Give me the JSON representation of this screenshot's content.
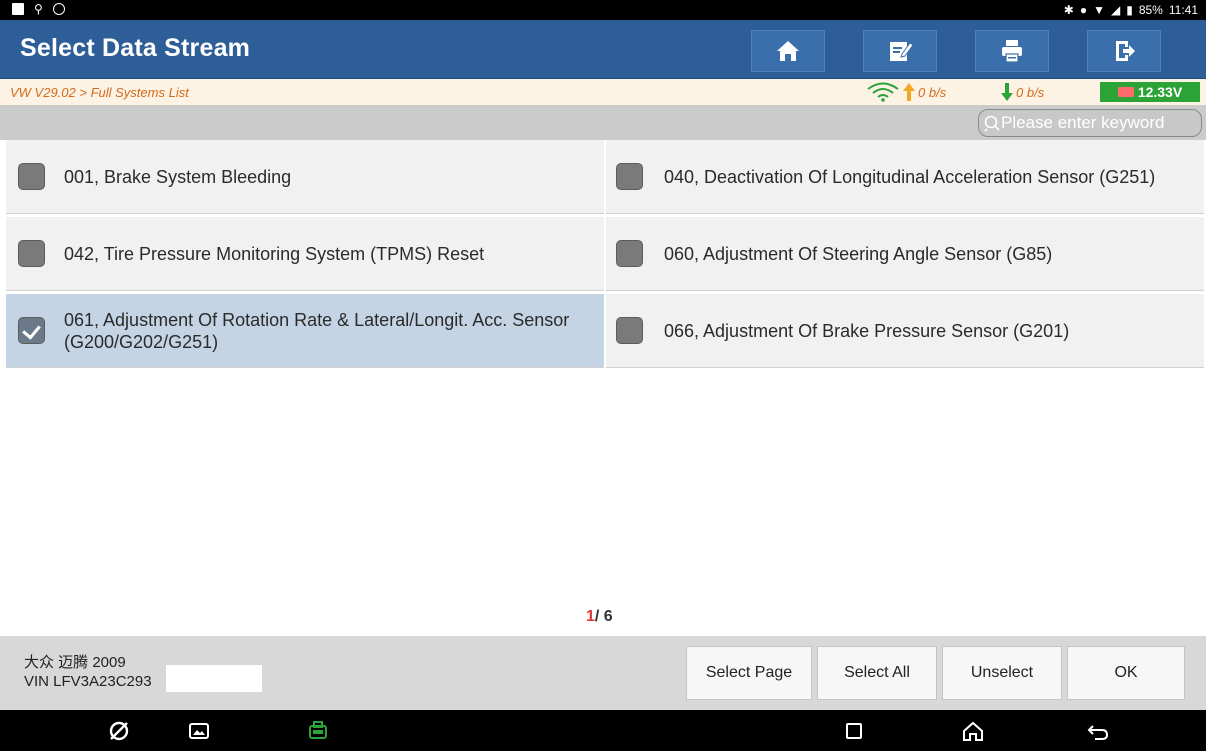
{
  "status_bar": {
    "battery_percent": "85%",
    "time": "11:41"
  },
  "titlebar": {
    "title": "Select Data Stream",
    "buttons": [
      "home-icon",
      "edit-icon",
      "print-icon",
      "exit-icon"
    ]
  },
  "crumbbar": {
    "breadcrumb": "VW V29.02 > Full Systems List",
    "upload_rate": "0 b/s",
    "download_rate": "0 b/s",
    "voltage": "12.33V"
  },
  "search": {
    "placeholder": "Please enter keyword"
  },
  "items": [
    {
      "label": "001, Brake System Bleeding",
      "checked": false
    },
    {
      "label": "040, Deactivation Of Longitudinal Acceleration Sensor (G251)",
      "checked": false
    },
    {
      "label": "042, Tire Pressure Monitoring System (TPMS) Reset",
      "checked": false
    },
    {
      "label": "060, Adjustment Of Steering Angle Sensor (G85)",
      "checked": false
    },
    {
      "label": "061, Adjustment Of Rotation Rate & Lateral/Longit. Acc. Sensor (G200/G202/G251)",
      "checked": true
    },
    {
      "label": "066, Adjustment Of Brake Pressure Sensor (G201)",
      "checked": false
    }
  ],
  "pager": {
    "current": "1",
    "total": "/ 6"
  },
  "footer": {
    "car_model": "大众 迈腾 2009",
    "vin": "VIN LFV3A23C293"
  },
  "actions": {
    "select_page": "Select Page",
    "select_all": "Select All",
    "unselect": "Unselect",
    "ok": "OK"
  },
  "colors": {
    "title_bar": "#2d5e97",
    "breadcrumb_text": "#d26a1c",
    "selected_row": "#c5d4e4",
    "voltage_badge": "#2ba336",
    "pager_current": "#e53935"
  }
}
